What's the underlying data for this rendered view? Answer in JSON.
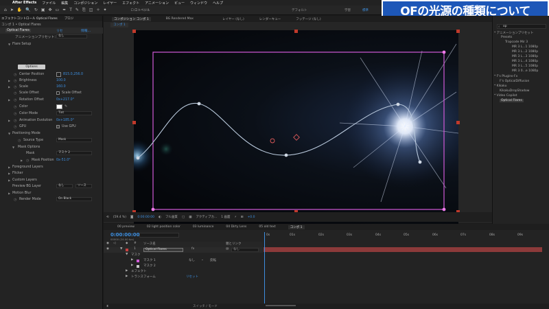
{
  "menubar": {
    "app": "After Effects",
    "items": [
      "ファイル",
      "編集",
      "コンポジション",
      "レイヤー",
      "エフェクト",
      "アニメーション",
      "ビュー",
      "ウィンドウ",
      "ヘルプ"
    ]
  },
  "toolbar": {
    "rotobrush": "ロトベジル",
    "workspaces": [
      "デフォルト",
      "学習",
      "標準"
    ]
  },
  "banner": "OFの光源の種類について",
  "effect_panel": {
    "tab_label": "エフェクトコントロール Optical Flares",
    "tab_project": "プロジ",
    "breadcrumb": "コンポ 1 • Optical Flares",
    "effect_name": "Optical Flares",
    "reset": "リセ",
    "info": "情報...",
    "preset_label": "アニメーションプリセット：",
    "preset_value": "なし",
    "rows": [
      {
        "label": "Flare Setup"
      },
      {
        "label": "Center Position",
        "value": "815.0,256.0"
      },
      {
        "label": "Brightness",
        "value": "100.0"
      },
      {
        "label": "Scale",
        "value": "160.0"
      },
      {
        "label": "Scale Offset",
        "check_label": "Scale Offset"
      },
      {
        "label": "Rotation Offset",
        "value": "0x+217.0°"
      },
      {
        "label": "Color"
      },
      {
        "label": "Color Mode",
        "dropdown": "Tint"
      },
      {
        "label": "Animation Evolution",
        "value": "0x+185.0°"
      },
      {
        "label": "GPU",
        "check_label": "Use GPU"
      },
      {
        "label": "Positioning Mode"
      },
      {
        "label": "Source Type",
        "dropdown": "Mask"
      },
      {
        "label": "Mask Options"
      },
      {
        "label": "Mask",
        "dropdown": "マスク 2"
      },
      {
        "label": "Mask Position",
        "value": "0x-51.0°"
      },
      {
        "label": "Foreground Layers"
      },
      {
        "label": "Flicker"
      },
      {
        "label": "Custom Layers"
      },
      {
        "label": "Preview BG Layer",
        "dropdown": "なし",
        "dropdown2": "ソース"
      },
      {
        "label": "Motion Blur"
      },
      {
        "label": "Render Mode",
        "dropdown": "On Black"
      }
    ],
    "options_button": "Options"
  },
  "viewer": {
    "tabs": [
      "コンポジション コンポ 1",
      "BG Rendered Max",
      "レイヤー (なし)",
      "レンダーキュー",
      "フッテージ (なし)"
    ],
    "subtab": "コンポ 1",
    "status": {
      "zoom": "(59.4 %)",
      "timecode": "0:00:00:00",
      "quality": "フル画質",
      "camera": "アクティブカ...",
      "views": "1 画面",
      "exposure": "+0.0"
    }
  },
  "right_panel": {
    "search": "op",
    "items": [
      "* アニメーションプリセット",
      "Presets",
      "Trapcode Mir 3",
      "MR 3 L...1 1080p",
      "MR 3 L...2 1080p",
      "MR 3 L...3 1080p",
      "MR 3 L...4 1080p",
      "MR 3 L...5 1080p",
      "MR 3 0...e 1080p",
      "* F's Plugins-Fx",
      "F's OpticalDiffusion",
      "* Kikaku",
      "KikakuDropShadow",
      "* Video Copilot",
      "Optical Flares"
    ]
  },
  "timeline": {
    "tabs": [
      "00 preview",
      "02 light position color",
      "03 luminance",
      "04 Dirty Lens",
      "05 old text",
      "コンポ 1"
    ],
    "timecode": "0:00:00:00",
    "timecode_sub": "00000 (24.00 fps)",
    "columns": {
      "source": "ソース名",
      "parent": "親とリンク"
    },
    "layer": {
      "index": "1",
      "name": "Optical Flares",
      "parent": "なし"
    },
    "groups": {
      "mask": "マスク",
      "mask1": "マスク 1",
      "mask1_mode": "なし",
      "mask1_invert": "反転",
      "mask2": "マスク 2",
      "effects": "エフェクト",
      "transform": "トランスフォーム",
      "transform_reset": "リセット"
    },
    "ruler": [
      "0s",
      "01s",
      "02s",
      "03s",
      "04s",
      "05s",
      "06s",
      "07s",
      "08s",
      "09s"
    ],
    "bottom": "スイッチ / モード"
  }
}
